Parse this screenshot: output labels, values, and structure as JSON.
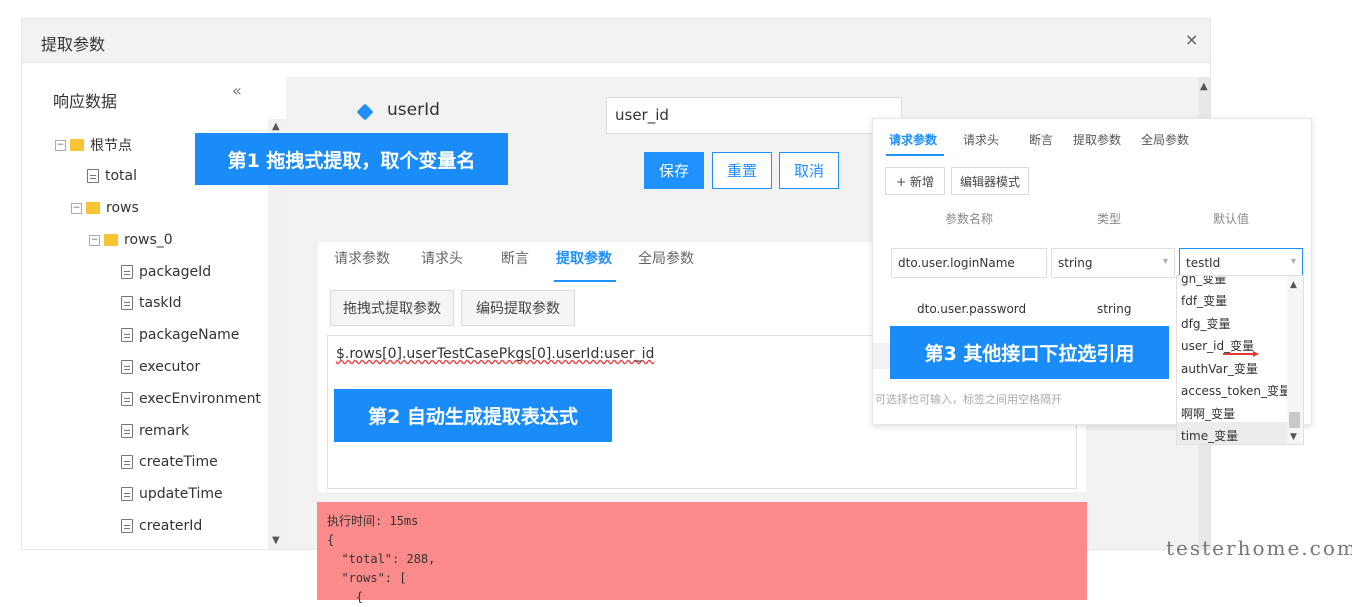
{
  "dialog": {
    "title": "提取参数",
    "close_glyph": "×"
  },
  "left": {
    "title": "响应数据",
    "collapse_glyph": "«",
    "tree": [
      {
        "label": "根节点",
        "type": "folder",
        "toggle": "−"
      },
      {
        "label": "total",
        "type": "file"
      },
      {
        "label": "rows",
        "type": "folder",
        "toggle": "−"
      },
      {
        "label": "rows_0",
        "type": "folder",
        "toggle": "−"
      },
      {
        "label": "packageId",
        "type": "file"
      },
      {
        "label": "taskId",
        "type": "file"
      },
      {
        "label": "packageName",
        "type": "file"
      },
      {
        "label": "executor",
        "type": "file"
      },
      {
        "label": "execEnvironment",
        "type": "file"
      },
      {
        "label": "remark",
        "type": "file"
      },
      {
        "label": "createTime",
        "type": "file"
      },
      {
        "label": "updateTime",
        "type": "file"
      },
      {
        "label": "createrId",
        "type": "file"
      }
    ]
  },
  "param": {
    "label": "userId",
    "input_value": "user_id",
    "save": "保存",
    "reset": "重置",
    "cancel": "取消"
  },
  "tabs": [
    "请求参数",
    "请求头",
    "断言",
    "提取参数",
    "全局参数"
  ],
  "extract": {
    "drag_btn": "拖拽式提取参数",
    "code_btn": "编码提取参数",
    "expression": "$.rows[0].userTestCasePkgs[0].userId:user_id"
  },
  "result": {
    "lines": [
      "执行时间: 15ms",
      "{",
      "  \"total\": 288,",
      "  \"rows\": [",
      "    {"
    ]
  },
  "callouts": {
    "c1": "第1 拖拽式提取，取个变量名",
    "c2": "第2 自动生成提取表达式",
    "c3": "第3 其他接口下拉选引用"
  },
  "overlay": {
    "tabs": [
      "请求参数",
      "请求头",
      "断言",
      "提取参数",
      "全局参数"
    ],
    "add_btn": "+ 新增",
    "edit_btn": "编辑器模式",
    "headers": [
      "参数名称",
      "类型",
      "默认值"
    ],
    "row1": {
      "name": "dto.user.loginName",
      "type": "string",
      "default": "testId"
    },
    "row2": {
      "name": "dto.user.password",
      "type": "string"
    },
    "placeholder": "可选择也可输入，标签之间用空格隔开",
    "dropdown": [
      "gh_变量",
      "fdf_变量",
      "dfg_变量",
      "user_id_变量",
      "authVar_变量",
      "access_token_变量",
      "啊啊_变量",
      "time_变量"
    ]
  },
  "watermark": "testerhome.com",
  "colors": {
    "primary": "#1e90ff",
    "callout": "#1a8cfa",
    "result_bg": "#fb8a8a",
    "folder": "#f7c434"
  }
}
